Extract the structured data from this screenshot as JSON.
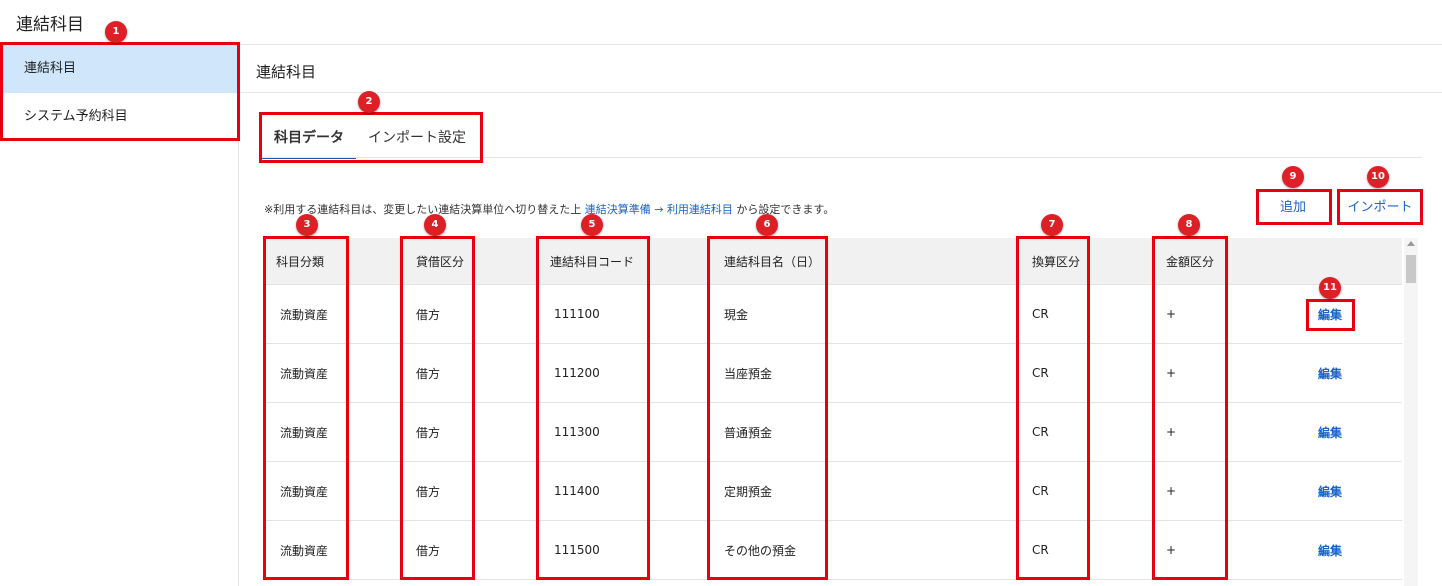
{
  "app": {
    "title": "連結科目"
  },
  "sidebar": {
    "items": [
      {
        "label": "連結科目"
      },
      {
        "label": "システム予約科目"
      }
    ]
  },
  "main": {
    "title": "連結科目",
    "tabs": [
      {
        "label": "科目データ"
      },
      {
        "label": "インポート設定"
      }
    ],
    "notice": {
      "prefix": "※利用する連結科目は、変更したい連結決算単位へ切り替えた上 ",
      "link": "連結決算準備 → 利用連結科目",
      "suffix": " から設定できます。"
    },
    "buttons": {
      "add": "追加",
      "import": "インポート"
    }
  },
  "table": {
    "headers": [
      "科目分類",
      "貸借区分",
      "連結科目コード",
      "連結科目名（日）",
      "換算区分",
      "金額区分"
    ],
    "edit_label": "編集",
    "rows": [
      [
        "流動資産",
        "借方",
        "111100",
        "現金",
        "CR",
        "+"
      ],
      [
        "流動資産",
        "借方",
        "111200",
        "当座預金",
        "CR",
        "+"
      ],
      [
        "流動資産",
        "借方",
        "111300",
        "普通預金",
        "CR",
        "+"
      ],
      [
        "流動資産",
        "借方",
        "111400",
        "定期預金",
        "CR",
        "+"
      ],
      [
        "流動資産",
        "借方",
        "111500",
        "その他の預金",
        "CR",
        "+"
      ]
    ]
  },
  "annotations": [
    "1",
    "2",
    "3",
    "4",
    "5",
    "6",
    "7",
    "8",
    "9",
    "10",
    "11"
  ],
  "colors": {
    "highlight": "#e8000d",
    "badge": "#dd1f26",
    "link": "#1a63c7",
    "sidebar_active": "#cfe6fb"
  }
}
